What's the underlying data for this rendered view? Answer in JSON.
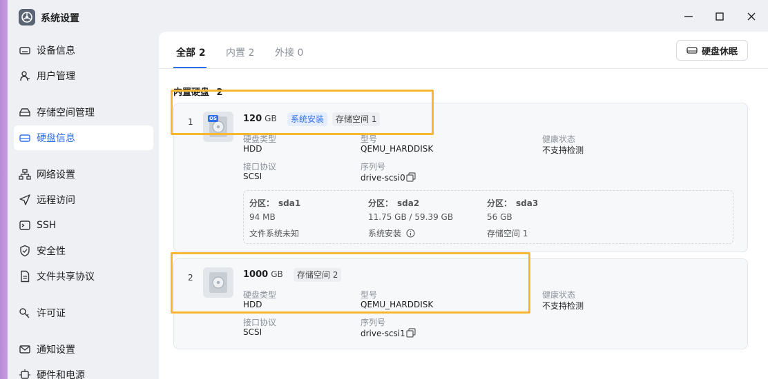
{
  "window": {
    "title": "系统设置"
  },
  "sidebar": {
    "items": [
      {
        "label": "设备信息",
        "icon": "device-icon"
      },
      {
        "label": "用户管理",
        "icon": "user-icon"
      },
      {
        "label": "存储空间管理",
        "icon": "storage-icon"
      },
      {
        "label": "硬盘信息",
        "icon": "disk-icon",
        "active": true
      },
      {
        "label": "网络设置",
        "icon": "network-icon"
      },
      {
        "label": "远程访问",
        "icon": "send-icon"
      },
      {
        "label": "SSH",
        "icon": "terminal-icon"
      },
      {
        "label": "安全性",
        "icon": "shield-icon"
      },
      {
        "label": "文件共享协议",
        "icon": "file-icon"
      },
      {
        "label": "许可证",
        "icon": "key-icon"
      },
      {
        "label": "通知设置",
        "icon": "mail-icon"
      },
      {
        "label": "硬件和电源",
        "icon": "power-icon"
      }
    ]
  },
  "tabs": [
    {
      "label": "全部 2",
      "active": true
    },
    {
      "label": "内置 2"
    },
    {
      "label": "外接 0"
    }
  ],
  "toolbar": {
    "sleep_label": "硬盘休眠"
  },
  "section": {
    "title": "内置硬盘",
    "count": "2"
  },
  "labels": {
    "type": "硬盘类型",
    "model": "型号",
    "health": "健康状态",
    "interface": "接口协议",
    "serial": "序列号",
    "partition": "分区："
  },
  "disks": [
    {
      "index": "1",
      "size": "120",
      "unit": "GB",
      "badge": "OS",
      "tags": [
        "系统安装",
        "存储空间 1"
      ],
      "type": "HDD",
      "model": "QEMU_HARDDISK",
      "health": "不支持检测",
      "interface": "SCSI",
      "serial": "drive-scsi0",
      "partitions": [
        {
          "name": "sda1",
          "size": "94 MB",
          "usage": "文件系统未知"
        },
        {
          "name": "sda2",
          "size": "11.75 GB / 59.39 GB",
          "usage": "系统安装"
        },
        {
          "name": "sda3",
          "size": "56 GB",
          "usage": "存储空间 1"
        }
      ]
    },
    {
      "index": "2",
      "size": "1000",
      "unit": "GB",
      "tags": [
        "存储空间 2"
      ],
      "type": "HDD",
      "model": "QEMU_HARDDISK",
      "health": "不支持检测",
      "interface": "SCSI",
      "serial": "drive-scsi1"
    }
  ],
  "colors": {
    "accent": "#2f6fec",
    "highlight": "#f7b731"
  }
}
